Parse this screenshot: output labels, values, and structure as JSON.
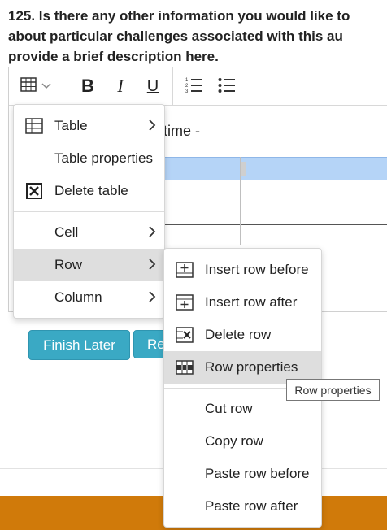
{
  "question": {
    "line1": "125. Is there any other information you would like to",
    "line2": "about particular challenges associated with this au",
    "line3": "provide a brief description here."
  },
  "editor": {
    "content_text": "time -"
  },
  "context_menu": {
    "items": [
      {
        "label": "Table"
      },
      {
        "label": "Table properties"
      },
      {
        "label": "Delete table"
      },
      {
        "label": "Cell"
      },
      {
        "label": "Row"
      },
      {
        "label": "Column"
      }
    ]
  },
  "row_submenu": {
    "items": [
      {
        "label": "Insert row before"
      },
      {
        "label": "Insert row after"
      },
      {
        "label": "Delete row"
      },
      {
        "label": "Row properties"
      },
      {
        "label": "Cut row"
      },
      {
        "label": "Copy row"
      },
      {
        "label": "Paste row before"
      },
      {
        "label": "Paste row after"
      }
    ]
  },
  "buttons": {
    "finish_later": "Finish Later",
    "partial": "Re"
  },
  "tooltip": "Row properties",
  "colors": {
    "button_bg": "#3aa9c4",
    "footer": "#d07a0a",
    "selected_cell": "#b5d4f7",
    "active_menu": "#dedede"
  }
}
